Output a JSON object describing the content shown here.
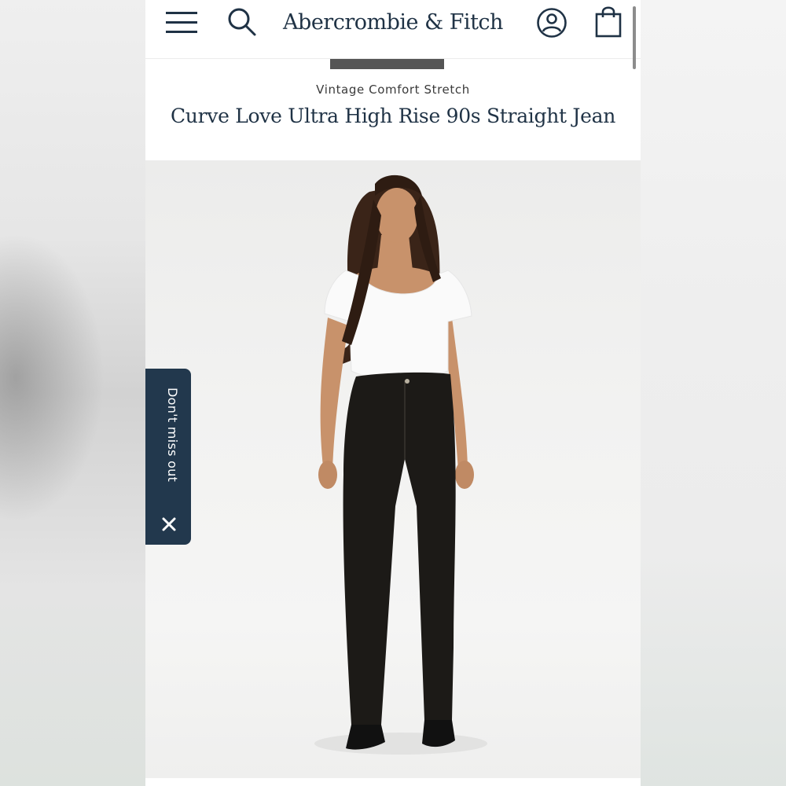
{
  "header": {
    "menu_icon": "hamburger-menu-icon",
    "search_icon": "search-icon",
    "logo_text": "Abercrombie & Fitch",
    "account_icon": "user-account-icon",
    "bag_icon": "shopping-bag-icon"
  },
  "product": {
    "collection": "Vintage Comfort Stretch",
    "name": "Curve Love Ultra High Rise 90s Straight Jean",
    "image": "model wearing black ultra high rise straight jeans and white tee"
  },
  "promo_tab": {
    "label": "Don't miss out",
    "close_icon": "close-icon"
  },
  "colors": {
    "brand_navy": "#1f3245",
    "promo_background": "#22384d",
    "indicator": "#555555"
  }
}
